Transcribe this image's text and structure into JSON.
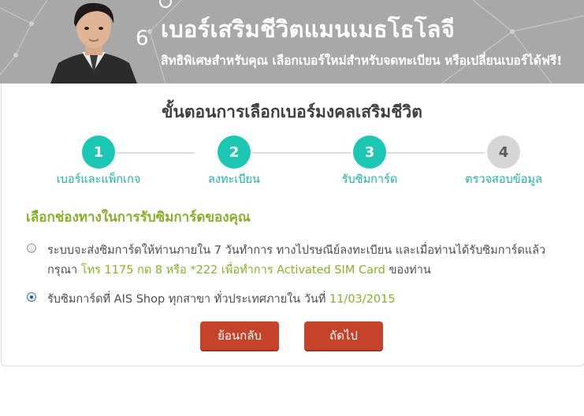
{
  "banner": {
    "title": "เบอร์เสริมชีวิตแมนเมธโธโลจี",
    "subtitle": "สิทธิพิเศษสำหรับคุณ เลือกเบอร์ใหม่สำหรับจดทะเบียน หรือเปลี่ยนเบอร์ได้ฟรี!",
    "number_digit": "6"
  },
  "heading": "ขั้นตอนการเลือกเบอร์มงคลเสริมชีวิต",
  "steps": [
    {
      "number": "1",
      "label": "เบอร์และแพ็กเกจ",
      "state": "active"
    },
    {
      "number": "2",
      "label": "ลงทะเบียน",
      "state": "active"
    },
    {
      "number": "3",
      "label": "รับซิมการ์ด",
      "state": "active"
    },
    {
      "number": "4",
      "label": "ตรวจสอบข้อมูล",
      "state": "inactive"
    }
  ],
  "section_title": "เลือกช่องทางในการรับซิมการ์ดของคุณ",
  "options": [
    {
      "line1": "ระบบจะส่งซิมการ์ดให้ท่านภายใน 7 วันทำการ ทางไปรษณีย์ลงทะเบียน และเมื่อท่านได้รับซิมการ์ดแล้ว",
      "line2_prefix": "กรุณา",
      "line2_highlight": "โทร 1175 กด 8 หรือ *222 เพื่อทำการ Activated SIM Card",
      "line2_suffix": "ของท่าน",
      "selected": false
    },
    {
      "text": "รับซิมการ์ดที่ AIS Shop ทุกสาขา ทั่วประเทศภายใน วันที่",
      "date": "11/03/2015",
      "selected": true
    }
  ],
  "buttons": {
    "back": "ย้อนกลับ",
    "next": "ถัดไป"
  },
  "colors": {
    "banner_bg": "#a8a8a8",
    "step_active": "#1cc7b4",
    "step_inactive": "#d6d6d6",
    "accent_green": "#86b029",
    "button": "#c4432a"
  }
}
